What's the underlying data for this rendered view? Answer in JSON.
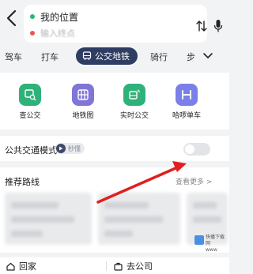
{
  "search": {
    "from": "我的位置",
    "to_placeholder": "输入终点"
  },
  "tabs": [
    {
      "label": "驾车"
    },
    {
      "label": "打车"
    },
    {
      "label": "公交地铁"
    },
    {
      "label": "骑行"
    },
    {
      "label": "步"
    }
  ],
  "tools": [
    {
      "label": "查公交",
      "icon": "bus-search-icon",
      "color": "#2fb27a"
    },
    {
      "label": "地铁图",
      "icon": "metro-map-icon",
      "color": "#8076d8"
    },
    {
      "label": "实时公交",
      "icon": "realtime-bus-icon",
      "color": "#2fb27a"
    },
    {
      "label": "哈啰单车",
      "icon": "bike-icon",
      "color": "#7a80e8"
    }
  ],
  "transit_mode": {
    "title": "公共交通模式",
    "badge": "秒懂",
    "enabled": false
  },
  "recommended": {
    "title": "推荐路线",
    "more": "查看更多 >"
  },
  "bottom": {
    "home": "回家",
    "work": "去公司"
  },
  "colors": {
    "active_tab": "#2f3d63",
    "arrow": "#e02020"
  }
}
